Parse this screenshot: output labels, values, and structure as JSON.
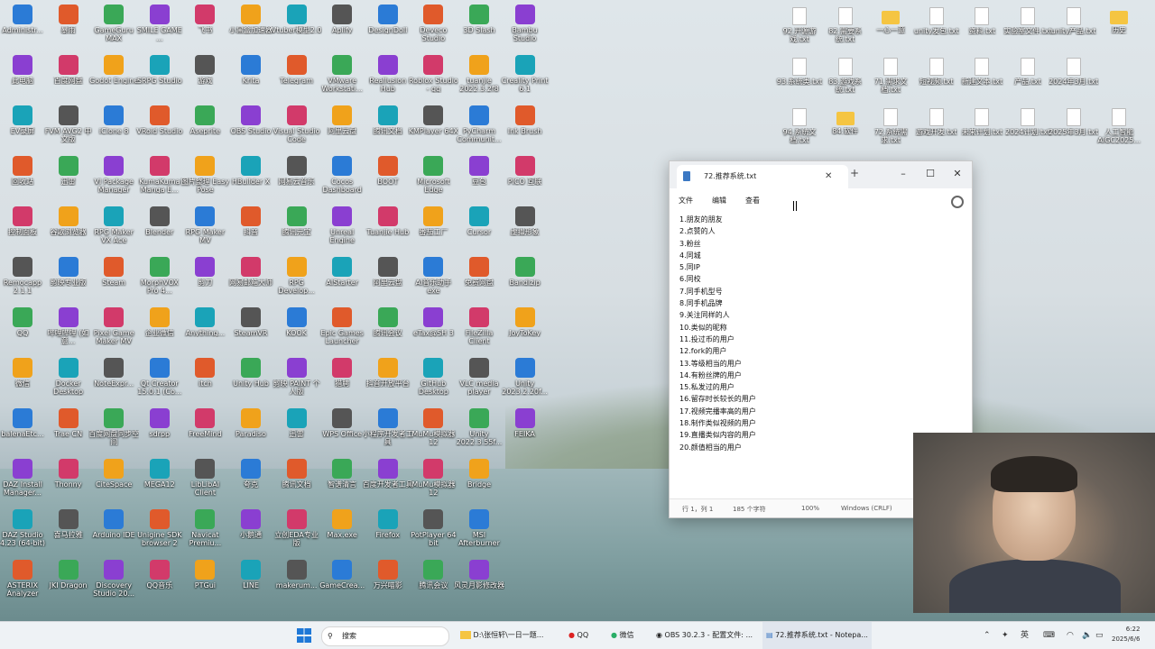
{
  "desktop_icons_left": [
    [
      "Administr...",
      "暴雨",
      "GameGuru MAX",
      "SMILE GAME ...",
      "飞书",
      "小黑盒加速器",
      "Vtuber模型2.0",
      "Aplify",
      "DesignDoll",
      "Deveco Studio",
      "3D Slash",
      "Bambu Studio"
    ],
    [
      "此电脑",
      "百度网盘",
      "Godot Engine",
      "SRPG Studio",
      "游戏",
      "Krita",
      "Telegram",
      "VMware Workstati...",
      "Reallusion Hub",
      "Roblox Studio - qq",
      "tuanjie 2022.3.2f8",
      "Creality Print 6.1"
    ],
    [
      "EV录屏",
      "FVM AVG2 中文版",
      "iClone 8",
      "VRoid Studio",
      "Aseprite",
      "OBS Studio",
      "Visual Studio Code",
      "阿里云盘",
      "腾讯文档",
      "KMPlayer 64X",
      "PyCharm Communit...",
      "Ink Brush"
    ],
    [
      "回收站",
      "迅雷",
      "VI Package Manager",
      "KumaKuma Manga E...",
      "图片整理 Easy Pose",
      "HBuilder X",
      "网易云音乐",
      "Cocos Dashboard",
      "BOOT",
      "Microsoft Edge",
      "豆包",
      "PICO 互联"
    ],
    [
      "控制面板",
      "谷歌浏览器",
      "RPG Maker VX Ace",
      "Blender",
      "RPG Maker MV",
      "抖音",
      "腾讯元宝",
      "Unreal Engine",
      "Tuanjie Hub",
      "番茄工厂",
      "Cursor",
      "虚拟形象"
    ],
    [
      "Remocapp 2.1.1",
      "剪映专业版",
      "Steam",
      "MorphVOX Pro 4...",
      "剪刀",
      "网易邮箱大师",
      "RPG Develop...",
      "AIStarter",
      "阿里云盘",
      "AI音乐助手 exe",
      "免费网盘",
      "Bandizip"
    ],
    [
      "QQ",
      "哔哩哔哩 (如意...",
      "Pixel Game Maker MV",
      "企业微信",
      "Anything...",
      "SteamVR",
      "KOOK",
      "Epic Games Launcher",
      "腾讯会议",
      "eTax@SH 3",
      "FileZilla Client",
      "JoyToKey"
    ],
    [
      "微信",
      "Docker Desktop",
      "NoteExpr...",
      "Qt Creator 15.0.1 (Co...",
      "itch",
      "Unity Hub",
      "剪映 PAINT 个人版",
      "猎聘",
      "抖音开放平台",
      "GitHub Desktop",
      "VLC media player",
      "Unity 2023.2.20f..."
    ],
    [
      "balenaEtc...",
      "Trae CN",
      "百度网盘同步空间",
      "sdrpp",
      "FreeMind",
      "Paradiso",
      "迅雷",
      "WPS Office",
      "小程序开发者工具",
      "MuMu模拟器12",
      "Unity 2022.3.55f...",
      "FEIKA"
    ],
    [
      "DAZ Install Manager...",
      "Thonny",
      "CiteSpace",
      "MEGA12",
      "LibLibAI Client",
      "夸克",
      "腾讯文档",
      "智谱清言",
      "百度开发者工具",
      "MuMu模拟器12",
      "Bridge",
      ""
    ],
    [
      "DAZ Studio 4.23 (64-bit)",
      "喜马拉雅",
      "Arduino IDE",
      "Unigine SDK browser 2",
      "Navicat Premiu...",
      "小鹅通",
      "立创EDA专业版",
      "Max.exe",
      "Firefox",
      "PotPlayer 64 bit",
      "MSI Afterburner",
      ""
    ],
    [
      "ASTERIX Analyzer",
      "JKI Dragon",
      "Discovery Studio 20...",
      "QQ音乐",
      "PTGui",
      "LINE",
      "makerum...",
      "GameCrea...",
      "万兴喵影",
      "腾讯会议",
      "风灵月影修改器",
      ""
    ]
  ],
  "desktop_icons_right": [
    [
      "92.开源游戏.txt",
      "82.需要系统.txt",
      "一心一意",
      "unity发包.txt",
      "资料.txt",
      "实验室文件.txt",
      "unity产品.txt",
      "历史"
    ],
    [
      "93.系统类.txt",
      "83.游戏系统.txt",
      "71.需求文档.txt",
      "短视频.txt",
      "新建文本.txt",
      "产品.txt",
      "2024年3月.txt",
      ""
    ],
    [
      "94.系统文档.txt",
      "84.软件",
      "72.系统需求.txt",
      "游戏开发.txt",
      "未来计划.txt",
      "2024计划.txt",
      "2025年3月.txt",
      "人工智能AIGC2025..."
    ]
  ],
  "notepad": {
    "tab_title": "72.推荐系统.txt",
    "menu": [
      "文件",
      "编辑",
      "查看"
    ],
    "lines": [
      "1.朋友的朋友",
      "2.点赞的人",
      "3.粉丝",
      "4.同城",
      "5.同IP",
      "6.同校",
      "7.同手机型号",
      "8.同手机品牌",
      "9.关注同样的人",
      "10.类似的昵称",
      "11.投过币的用户",
      "12.fork的用户",
      "13.等级相当的用户",
      "14.有粉丝牌的用户",
      "15.私发过的用户",
      "16.留存时长较长的用户",
      "17.视频完播率高的用户",
      "18.制作类似视频的用户",
      "19.直播类似内容的用户",
      "20.颜值相当的用户"
    ],
    "status": {
      "position": "行 1，列 1",
      "chars": "185 个字符",
      "zoom": "100%",
      "eol": "Windows (CRLF)"
    }
  },
  "taskbar": {
    "search_placeholder": "搜索",
    "items": [
      "D:\\张恒轩\\一日一题...",
      "QQ",
      "微信",
      "OBS 30.2.3 - 配置文件: ...",
      "72.推荐系统.txt - Notepa..."
    ],
    "tray": {
      "time": "6:22",
      "date": "2025/6/6",
      "ime": "英"
    }
  }
}
